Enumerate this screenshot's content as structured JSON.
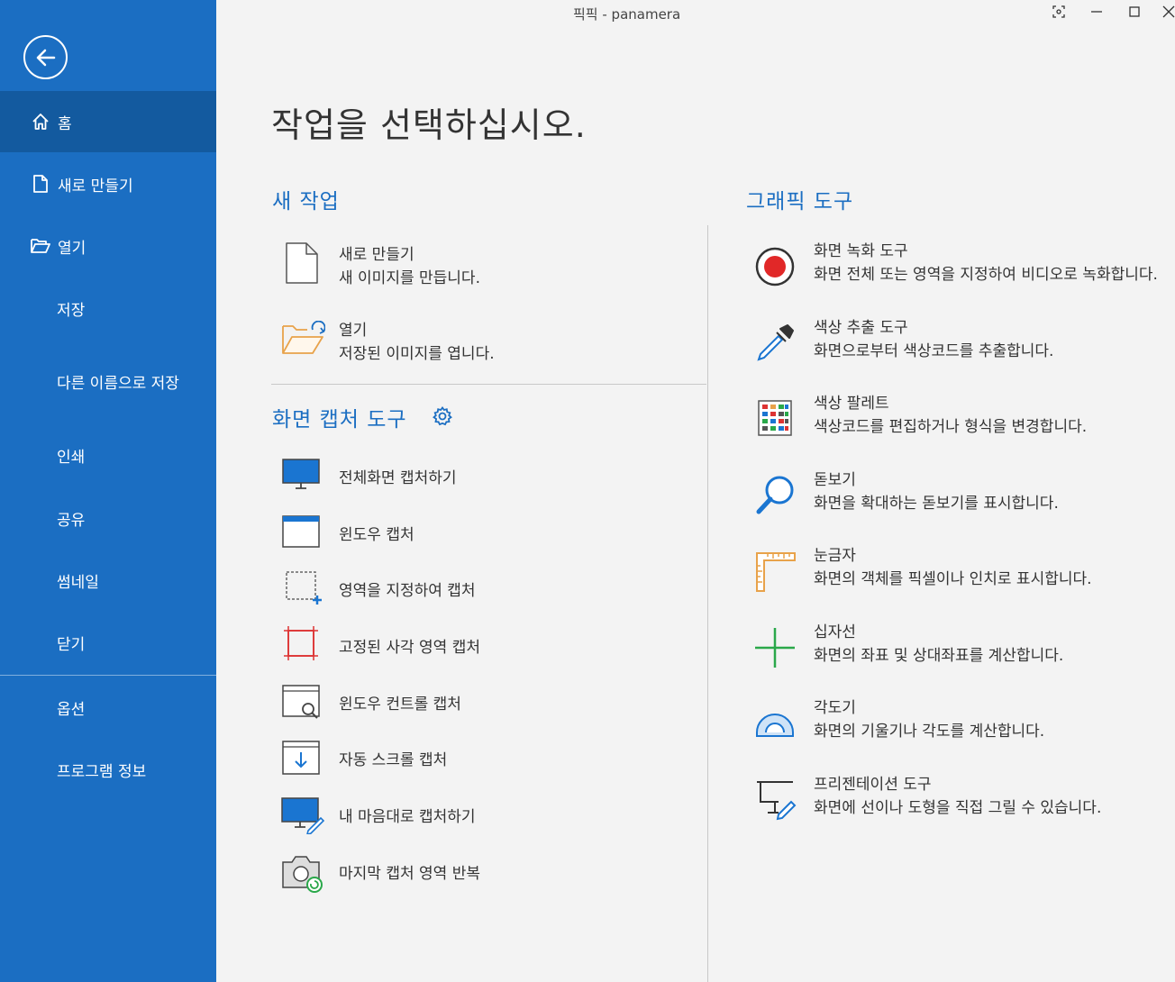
{
  "window": {
    "title": "픽픽 - panamera"
  },
  "sidebar": {
    "items": [
      {
        "label": "홈",
        "icon": "home-icon"
      },
      {
        "label": "새로 만들기",
        "icon": "new-file-icon"
      },
      {
        "label": "열기",
        "icon": "open-folder-icon"
      },
      {
        "label": "저장"
      },
      {
        "label": "다른 이름으로 저장"
      },
      {
        "label": "인쇄"
      },
      {
        "label": "공유"
      },
      {
        "label": "썸네일"
      },
      {
        "label": "닫기"
      },
      {
        "label": "옵션"
      },
      {
        "label": "프로그램 정보"
      }
    ]
  },
  "main": {
    "heading": "작업을 선택하십시오.",
    "new_task": {
      "title": "새 작업",
      "items": [
        {
          "title": "새로 만들기",
          "desc": "새 이미지를 만듭니다."
        },
        {
          "title": "열기",
          "desc": "저장된 이미지를 엽니다."
        }
      ]
    },
    "capture": {
      "title": "화면 캡처 도구",
      "items": [
        {
          "label": "전체화면 캡처하기",
          "icon": "monitor-icon"
        },
        {
          "label": "윈도우 캡처",
          "icon": "window-icon"
        },
        {
          "label": "영역을 지정하여 캡처",
          "icon": "region-select-icon"
        },
        {
          "label": "고정된 사각 영역 캡처",
          "icon": "fixed-rect-icon"
        },
        {
          "label": "윈도우 컨트롤 캡처",
          "icon": "window-control-icon"
        },
        {
          "label": "자동 스크롤 캡처",
          "icon": "scroll-capture-icon"
        },
        {
          "label": "내 마음대로 캡처하기",
          "icon": "freehand-capture-icon"
        },
        {
          "label": "마지막 캡처 영역 반복",
          "icon": "repeat-capture-icon"
        }
      ]
    },
    "graphics": {
      "title": "그래픽 도구",
      "items": [
        {
          "title": "화면 녹화 도구",
          "desc": "화면 전체 또는 영역을 지정하여 비디오로 녹화합니다.",
          "icon": "record-icon"
        },
        {
          "title": "색상 추출 도구",
          "desc": "화면으로부터 색상코드를 추출합니다.",
          "icon": "eyedropper-icon"
        },
        {
          "title": "색상 팔레트",
          "desc": "색상코드를 편집하거나 형식을 변경합니다.",
          "icon": "palette-icon"
        },
        {
          "title": "돋보기",
          "desc": "화면을 확대하는 돋보기를 표시합니다.",
          "icon": "magnifier-icon"
        },
        {
          "title": "눈금자",
          "desc": "화면의 객체를 픽셀이나 인치로 표시합니다.",
          "icon": "ruler-icon"
        },
        {
          "title": "십자선",
          "desc": "화면의 좌표 및 상대좌표를 계산합니다.",
          "icon": "crosshair-icon"
        },
        {
          "title": "각도기",
          "desc": "화면의 기울기나 각도를 계산합니다.",
          "icon": "protractor-icon"
        },
        {
          "title": "프리젠테이션 도구",
          "desc": "화면에 선이나 도형을 직접 그릴 수 있습니다.",
          "icon": "presentation-icon"
        }
      ]
    }
  },
  "colors": {
    "sidebar": "#1b6ec2",
    "sidebar_active": "#135a9f",
    "accent": "#1b6ec2",
    "background": "#f3f3f3"
  }
}
